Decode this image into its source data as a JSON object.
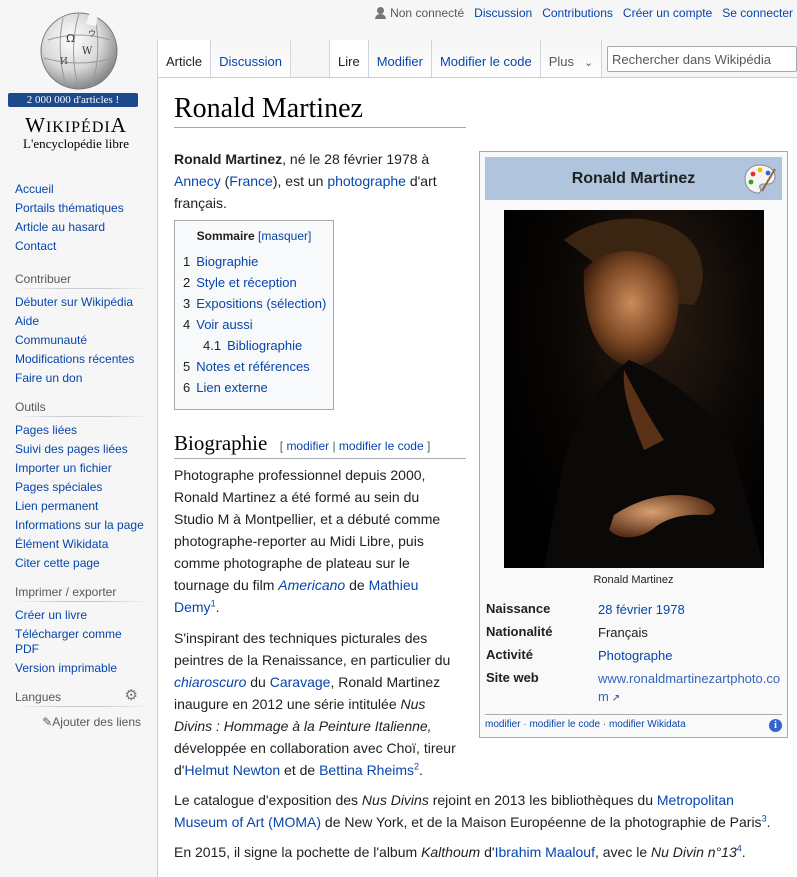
{
  "logo": {
    "badge": "2 000 000 d'articles !",
    "wordmark": "Wikipédia",
    "tagline": "L'encyclopédie libre"
  },
  "personal": {
    "not_logged": "Non connecté",
    "discussion": "Discussion",
    "contributions": "Contributions",
    "create_account": "Créer un compte",
    "login": "Se connecter"
  },
  "tabs": {
    "article": "Article",
    "discussion": "Discussion",
    "read": "Lire",
    "edit": "Modifier",
    "edit_source": "Modifier le code",
    "more": "Plus"
  },
  "search": {
    "placeholder": "Rechercher dans Wikipédia"
  },
  "sidebar": {
    "nav": [
      "Accueil",
      "Portails thématiques",
      "Article au hasard",
      "Contact"
    ],
    "contribute_title": "Contribuer",
    "contribute": [
      "Débuter sur Wikipédia",
      "Aide",
      "Communauté",
      "Modifications récentes",
      "Faire un don"
    ],
    "tools_title": "Outils",
    "tools": [
      "Pages liées",
      "Suivi des pages liées",
      "Importer un fichier",
      "Pages spéciales",
      "Lien permanent",
      "Informations sur la page",
      "Élément Wikidata",
      "Citer cette page"
    ],
    "print_title": "Imprimer / exporter",
    "print": [
      "Créer un livre",
      "Télécharger comme PDF",
      "Version imprimable"
    ],
    "lang_title": "Langues",
    "add_links": "Ajouter des liens"
  },
  "article": {
    "title": "Ronald Martinez",
    "intro": {
      "name": "Ronald Martinez",
      "t1": ", né le 28 février 1978 à ",
      "annecy": "Annecy",
      "t2": " (",
      "france": "France",
      "t3": "), est un ",
      "photographe": "photographe",
      "t4": " d'art français."
    },
    "toc": {
      "title": "Sommaire",
      "toggle": "[masquer]",
      "items": [
        {
          "num": "1",
          "label": "Biographie"
        },
        {
          "num": "2",
          "label": "Style et réception"
        },
        {
          "num": "3",
          "label": "Expositions (sélection)"
        },
        {
          "num": "4",
          "label": "Voir aussi"
        },
        {
          "num": "4.1",
          "label": "Bibliographie"
        },
        {
          "num": "5",
          "label": "Notes et références"
        },
        {
          "num": "6",
          "label": "Lien externe"
        }
      ]
    },
    "bio": {
      "heading": "Biographie",
      "edit_open": "[ ",
      "edit": "modifier",
      "sep": " | ",
      "edit_source": "modifier le code",
      "edit_close": " ]"
    },
    "p1": {
      "t1": "Photographe professionnel depuis 2000, Ronald Martinez a été formé au sein du Studio M à Montpellier, et a débuté comme photographe-reporter au Midi Libre, puis comme photographe de plateau sur le tournage du film ",
      "americano": "Americano",
      "t2": " de ",
      "demy": "Mathieu Demy",
      "ref": "1",
      "t3": "."
    },
    "p2": {
      "t1": "S'inspirant des techniques picturales des peintres de la Renaissance, en particulier du ",
      "chiaroscuro": "chiaroscuro",
      "t2": " du ",
      "caravage": "Caravage",
      "t3": ", Ronald Martinez inaugure en 2012 une série intitulée ",
      "nus": "Nus Divins : Hommage à la Peinture Italienne,",
      "t4": " développée en collaboration avec Choï, tireur d'",
      "newton": "Helmut Newton",
      "t5": " et de ",
      "rheims": "Bettina Rheims",
      "ref": "2",
      "t6": "."
    },
    "p3": {
      "t1": "Le catalogue d'exposition des ",
      "nus": "Nus Divins",
      "t2": " rejoint en 2013 les bibliothèques du ",
      "moma": "Metropolitan Museum of Art (MOMA)",
      "t3": " de New York, et de la Maison Européenne de la photographie de Paris",
      "ref": "3",
      "t4": "."
    },
    "p4": {
      "t1": "En 2015, il signe la pochette de l'album ",
      "album": "Kalthoum",
      "t2": " d'",
      "maalouf": "Ibrahim Maalouf",
      "t3": ", avec le ",
      "nu": "Nu Divin n°13",
      "ref": "4",
      "t4": "."
    }
  },
  "infobox": {
    "title": "Ronald Martinez",
    "caption": "Ronald Martinez",
    "rows": [
      {
        "k": "Naissance",
        "v": "28 février 1978"
      },
      {
        "k": "Nationalité",
        "v": "Français"
      },
      {
        "k": "Activité",
        "v": "Photographe"
      },
      {
        "k": "Site web",
        "v": "www.ronaldmartinezartphoto.com"
      }
    ],
    "footer": {
      "edit": "modifier",
      "edit_source": "modifier le code",
      "edit_wikidata": "modifier Wikidata",
      "sep": " · "
    }
  },
  "colors": {
    "link": "#0645ad",
    "infobox_header": "#b0c4de",
    "badge": "#1c4a8c"
  }
}
